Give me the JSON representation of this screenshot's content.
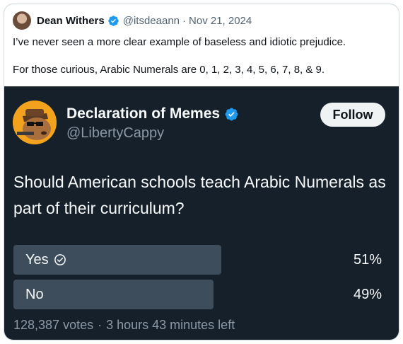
{
  "quote_tweet": {
    "author_name": "Dean Withers",
    "author_handle": "@itsdeaann",
    "separator": "·",
    "date": "Nov 21, 2024",
    "text_line1": "I’ve never seen a more clear example of baseless and idiotic prejudice.",
    "text_line2": "For those curious, Arabic Numerals are 0, 1, 2, 3, 4, 5, 6, 7, 8, & 9."
  },
  "embedded_tweet": {
    "author_name": "Declaration of Memes",
    "author_handle": "@LibertyCappy",
    "follow_label": "Follow",
    "question": "Should American schools teach Arabic Numerals as part of their curriculum?",
    "poll": {
      "options": [
        {
          "label": "Yes",
          "percent_label": "51%",
          "percent": 51,
          "winner": true
        },
        {
          "label": "No",
          "percent_label": "49%",
          "percent": 49,
          "winner": false
        }
      ],
      "votes": "128,387 votes",
      "separator": "·",
      "time_left": "3 hours 43 minutes left"
    }
  },
  "colors": {
    "verified_blue": "#1d9bf0",
    "embed_background": "#15202b",
    "poll_bar": "#3d4d5c",
    "muted_text": "#8b98a5"
  },
  "icons": [
    "verified-badge-icon",
    "check-circle-icon"
  ]
}
